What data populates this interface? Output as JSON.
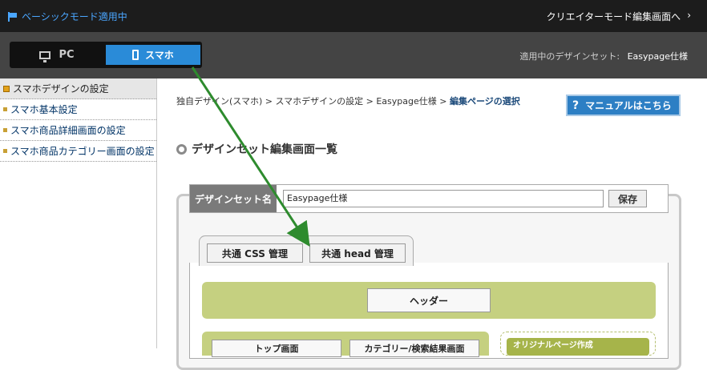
{
  "topbar": {
    "mode_label": "ベーシックモード適用中",
    "creator_link": "クリエイターモード編集画面へ",
    "creator_chevron": "›"
  },
  "device": {
    "pc_label": "PC",
    "sp_label": "スマホ"
  },
  "designset": {
    "label": "適用中のデザインセット:",
    "value": "Easypage仕様"
  },
  "sidebar": {
    "items": [
      {
        "label": "スマホデザインの設定"
      },
      {
        "label": "スマホ基本設定"
      },
      {
        "label": "スマホ商品詳細画面の設定"
      },
      {
        "label": "スマホ商品カテゴリー画面の設定"
      }
    ]
  },
  "breadcrumb": {
    "path": "独自デザイン(スマホ) > スマホデザインの設定 > Easypage仕様 > ",
    "current": "編集ページの選択"
  },
  "manual": {
    "icon": "?",
    "label": "マニュアルはこちら"
  },
  "section": {
    "title": "デザインセット編集画面一覧"
  },
  "name_row": {
    "label": "デザインセット名",
    "value": "Easypage仕様",
    "save_label": "保存"
  },
  "tabs": {
    "css_label": "共通 CSS 管理",
    "head_label": "共通 head 管理"
  },
  "content": {
    "header_label": "ヘッダー",
    "top_label": "トップ画面",
    "category_label": "カテゴリー/検索結果画面",
    "original_label": "オリジナルページ作成"
  },
  "colors": {
    "accent_blue": "#2a8bd8",
    "header_green": "#c5d080",
    "arrow_green": "#2e8b2e"
  }
}
